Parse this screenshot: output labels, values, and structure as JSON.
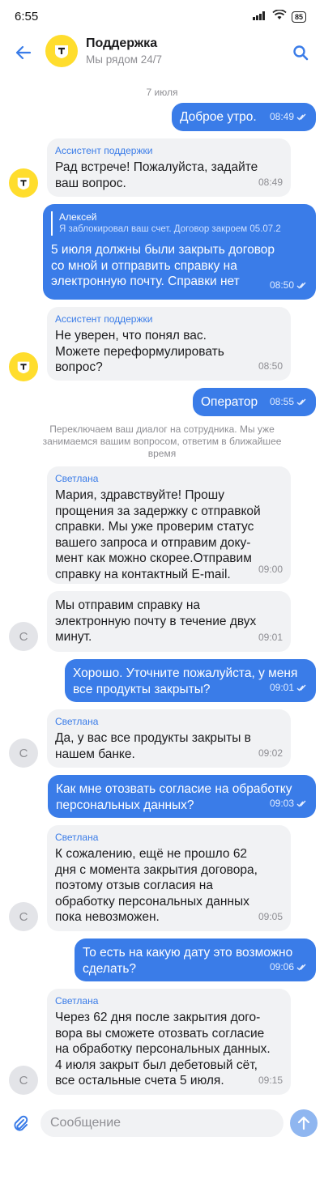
{
  "status_bar": {
    "time": "6:55",
    "battery": "85"
  },
  "header": {
    "title": "Поддержка",
    "subtitle": "Мы рядом 24/7"
  },
  "date_separator": "7 июля",
  "system_note": "Переключаем ваш диалог на сотрудника. Мы уже занимаемся вашим вопросом, ответим в ближайшее время",
  "messages": [
    {
      "dir": "out",
      "text": "Доброе утро.",
      "time": "08:49"
    },
    {
      "dir": "in",
      "sender": "Ассистент поддержки",
      "text": "Рад встрече! Пожалуйста, задайте\nваш вопрос.",
      "time": "08:49"
    },
    {
      "dir": "out",
      "reply_name": "Алексей",
      "reply_text": "Я заблокировал ваш счет. Договор закроем 05.07.2",
      "text": "5 июля должны были закрыть договор\nсо мной и отправить справку на\nэлектронную почту. Справки нет",
      "time": "08:50"
    },
    {
      "dir": "in",
      "sender": "Ассистент поддержки",
      "text": "Не уверен, что понял вас.\nМожете переформулировать\nвопрос?",
      "time": "08:50"
    },
    {
      "dir": "out",
      "text": "Оператор",
      "time": "08:55"
    },
    {
      "dir": "in",
      "sender": "Светлана",
      "text": "Мария, здравствуйте! Прошу\nпрощения за задержку с отправкой\nсправки. Мы уже проверим статус\nвашего запроса и отправим доку-\nмент как можно скорее.Отправим\nсправку на контактный E-mail.",
      "time": "09:00"
    },
    {
      "dir": "in",
      "text": "Мы отправим справку на\nэлектронную почту в течение двух\nминут.",
      "time": "09:01"
    },
    {
      "dir": "out",
      "text": "Хорошо. Уточните пожалуйста, у меня\nвсе продукты закрыты?",
      "time": "09:01"
    },
    {
      "dir": "in",
      "sender": "Светлана",
      "text": "Да, у вас все продукты закрыты в\nнашем банке.",
      "time": "09:02"
    },
    {
      "dir": "out",
      "text": "Как мне отозвать согласие на обработку\nперсональных данных?",
      "time": "09:03"
    },
    {
      "dir": "in",
      "sender": "Светлана",
      "text": "К сожалению, ещё не прошло 62\nдня с момента закрытия договора,\nпоэтому отзыв согласия на\nобработку персональных данных\nпока невозможен.",
      "time": "09:05"
    },
    {
      "dir": "out",
      "text": "То есть на какую дату это возможно\nсделать?",
      "time": "09:06"
    },
    {
      "dir": "in",
      "sender": "Светлана",
      "text": "Через 62 дня после закрытия дого-\nвора вы сможете отозвать согласие\nна обработку персональных данных.\n4 июля закрыт был дебетовый сёт,\nвсе остальные счета 5 июля.",
      "time": "09:15"
    }
  ],
  "avatars": {
    "bot_letter": "т",
    "operator_letter": "С"
  },
  "composer": {
    "placeholder": "Сообщение"
  },
  "colors": {
    "accent": "#3a7ce8",
    "brand_yellow": "#ffdd2d",
    "incoming_bg": "#f1f2f4"
  },
  "icons": [
    "back-arrow-icon",
    "search-icon",
    "paperclip-icon",
    "send-arrow-icon",
    "double-check-icon"
  ]
}
